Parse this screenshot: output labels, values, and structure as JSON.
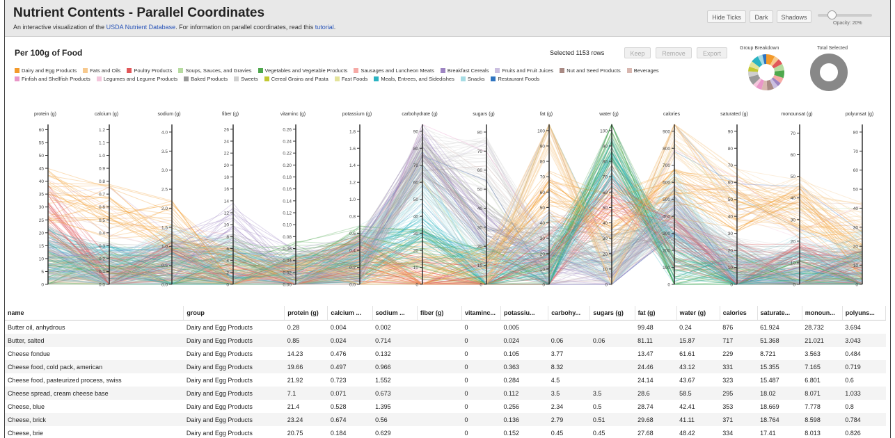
{
  "header": {
    "title": "Nutrient Contents - Parallel Coordinates",
    "subtitle_pre": "An interactive visualization of the ",
    "subtitle_link1": "USDA Nutrient Database",
    "subtitle_mid": ". For information on parallel coordinates, read this ",
    "subtitle_link2": "tutorial",
    "subtitle_post": ".",
    "buttons": {
      "hide_ticks": "Hide Ticks",
      "dark": "Dark",
      "shadows": "Shadows"
    },
    "opacity_label": "Opacity: 20%",
    "opacity_value": 0.2
  },
  "controls": {
    "section_title": "Per 100g of Food",
    "selected_text": "Selected 1153 rows",
    "keep": "Keep",
    "remove": "Remove",
    "export": "Export",
    "group_breakdown_label": "Group Breakdown",
    "total_selected_label": "Total Selected"
  },
  "legend": [
    {
      "label": "Dairy and Egg Products",
      "color": "#f39a2b"
    },
    {
      "label": "Fats and Oils",
      "color": "#f7c98e"
    },
    {
      "label": "Poultry Products",
      "color": "#e15759"
    },
    {
      "label": "Soups, Sauces, and Gravies",
      "color": "#b6dba0"
    },
    {
      "label": "Vegetables and Vegetable Products",
      "color": "#4fa84d"
    },
    {
      "label": "Sausages and Luncheon Meats",
      "color": "#f6aaa6"
    },
    {
      "label": "Breakfast Cereals",
      "color": "#9d84c2"
    },
    {
      "label": "Fruits and Fruit Juices",
      "color": "#cbbfe0"
    },
    {
      "label": "Nut and Seed Products",
      "color": "#a98a84"
    },
    {
      "label": "Beverages",
      "color": "#d8b7b0"
    },
    {
      "label": "Finfish and Shellfish Products",
      "color": "#e996c8"
    },
    {
      "label": "Legumes and Legume Products",
      "color": "#f4c6dc"
    },
    {
      "label": "Baked Products",
      "color": "#999999"
    },
    {
      "label": "Sweets",
      "color": "#cfcfcf"
    },
    {
      "label": "Cereal Grains and Pasta",
      "color": "#c2c832"
    },
    {
      "label": "Fast Foods",
      "color": "#e3e39a"
    },
    {
      "label": "Meals, Entrees, and Sidedishes",
      "color": "#2ab3c2"
    },
    {
      "label": "Snacks",
      "color": "#a6dce4"
    },
    {
      "label": "Restaurant Foods",
      "color": "#2f74c0"
    }
  ],
  "chart_data": {
    "type": "parallel-coordinates",
    "axes": [
      {
        "name": "protein (g)",
        "ticks": [
          "60",
          "55",
          "50",
          "45",
          "40",
          "35",
          "30",
          "25",
          "20",
          "15",
          "10",
          "5",
          "0"
        ]
      },
      {
        "name": "calcium (g)",
        "ticks": [
          "1.2",
          "1.1",
          "1.0",
          "0.9",
          "0.8",
          "0.7",
          "0.6",
          "0.5",
          "0.4",
          "0.3",
          "0.2",
          "0.1",
          "0.0"
        ]
      },
      {
        "name": "sodium (g)",
        "ticks": [
          "4.0",
          "3.5",
          "3.0",
          "2.5",
          "2.0",
          "1.5",
          "1.0",
          "0.5",
          "0.0"
        ]
      },
      {
        "name": "fiber (g)",
        "ticks": [
          "26",
          "24",
          "22",
          "20",
          "18",
          "16",
          "14",
          "12",
          "10",
          "8",
          "6",
          "4",
          "2",
          "0"
        ]
      },
      {
        "name": "vitaminc (g)",
        "ticks": [
          "0.26",
          "0.24",
          "0.22",
          "0.20",
          "0.18",
          "0.16",
          "0.14",
          "0.12",
          "0.10",
          "0.08",
          "0.06",
          "0.04",
          "0.02",
          "0.00"
        ]
      },
      {
        "name": "potassium (g)",
        "ticks": [
          "1.8",
          "1.6",
          "1.4",
          "1.2",
          "1.0",
          "0.8",
          "0.6",
          "0.4",
          "0.2",
          "0.0"
        ]
      },
      {
        "name": "carbohydrate (g)",
        "ticks": [
          "90",
          "80",
          "70",
          "60",
          "50",
          "40",
          "30",
          "20",
          "10",
          "0"
        ]
      },
      {
        "name": "sugars (g)",
        "ticks": [
          "80",
          "70",
          "60",
          "50",
          "40",
          "30",
          "20",
          "10",
          "0"
        ]
      },
      {
        "name": "fat (g)",
        "ticks": [
          "100",
          "90",
          "80",
          "70",
          "60",
          "50",
          "40",
          "30",
          "20",
          "10",
          "0"
        ]
      },
      {
        "name": "water (g)",
        "ticks": [
          "100",
          "90",
          "80",
          "70",
          "60",
          "50",
          "40",
          "30",
          "20",
          "10",
          "0"
        ]
      },
      {
        "name": "calories",
        "ticks": [
          "900",
          "800",
          "700",
          "600",
          "500",
          "400",
          "300",
          "200",
          "100",
          "0"
        ]
      },
      {
        "name": "saturated (g)",
        "ticks": [
          "90",
          "80",
          "70",
          "60",
          "50",
          "40",
          "30",
          "20",
          "10",
          "0"
        ]
      },
      {
        "name": "monounsat (g)",
        "ticks": [
          "70",
          "60",
          "50",
          "40",
          "30",
          "20",
          "10",
          "0"
        ]
      },
      {
        "name": "polyunsat (g)",
        "ticks": [
          "80",
          "70",
          "60",
          "50",
          "40",
          "30",
          "20",
          "10",
          "0"
        ]
      }
    ],
    "opacity": 0.2,
    "selected_rows": 1153
  },
  "table": {
    "columns": [
      "name",
      "group",
      "protein (g)",
      "calcium ...",
      "sodium ...",
      "fiber (g)",
      "vitaminc...",
      "potassiu...",
      "carbohy...",
      "sugars (g)",
      "fat (g)",
      "water (g)",
      "calories",
      "saturate...",
      "monoun...",
      "polyuns..."
    ],
    "rows": [
      [
        "Butter oil, anhydrous",
        "Dairy and Egg Products",
        "0.28",
        "0.004",
        "0.002",
        "",
        "0",
        "0.005",
        "",
        "",
        "99.48",
        "0.24",
        "876",
        "61.924",
        "28.732",
        "3.694"
      ],
      [
        "Butter, salted",
        "Dairy and Egg Products",
        "0.85",
        "0.024",
        "0.714",
        "",
        "0",
        "0.024",
        "0.06",
        "0.06",
        "81.11",
        "15.87",
        "717",
        "51.368",
        "21.021",
        "3.043"
      ],
      [
        "Cheese fondue",
        "Dairy and Egg Products",
        "14.23",
        "0.476",
        "0.132",
        "",
        "0",
        "0.105",
        "3.77",
        "",
        "13.47",
        "61.61",
        "229",
        "8.721",
        "3.563",
        "0.484"
      ],
      [
        "Cheese food, cold pack, american",
        "Dairy and Egg Products",
        "19.66",
        "0.497",
        "0.966",
        "",
        "0",
        "0.363",
        "8.32",
        "",
        "24.46",
        "43.12",
        "331",
        "15.355",
        "7.165",
        "0.719"
      ],
      [
        "Cheese food, pasteurized process, swiss",
        "Dairy and Egg Products",
        "21.92",
        "0.723",
        "1.552",
        "",
        "0",
        "0.284",
        "4.5",
        "",
        "24.14",
        "43.67",
        "323",
        "15.487",
        "6.801",
        "0.6"
      ],
      [
        "Cheese spread, cream cheese base",
        "Dairy and Egg Products",
        "7.1",
        "0.071",
        "0.673",
        "",
        "0",
        "0.112",
        "3.5",
        "3.5",
        "28.6",
        "58.5",
        "295",
        "18.02",
        "8.071",
        "1.033"
      ],
      [
        "Cheese, blue",
        "Dairy and Egg Products",
        "21.4",
        "0.528",
        "1.395",
        "",
        "0",
        "0.256",
        "2.34",
        "0.5",
        "28.74",
        "42.41",
        "353",
        "18.669",
        "7.778",
        "0.8"
      ],
      [
        "Cheese, brick",
        "Dairy and Egg Products",
        "23.24",
        "0.674",
        "0.56",
        "",
        "0",
        "0.136",
        "2.79",
        "0.51",
        "29.68",
        "41.11",
        "371",
        "18.764",
        "8.598",
        "0.784"
      ],
      [
        "Cheese, brie",
        "Dairy and Egg Products",
        "20.75",
        "0.184",
        "0.629",
        "",
        "0",
        "0.152",
        "0.45",
        "0.45",
        "27.68",
        "48.42",
        "334",
        "17.41",
        "8.013",
        "0.826"
      ]
    ]
  }
}
